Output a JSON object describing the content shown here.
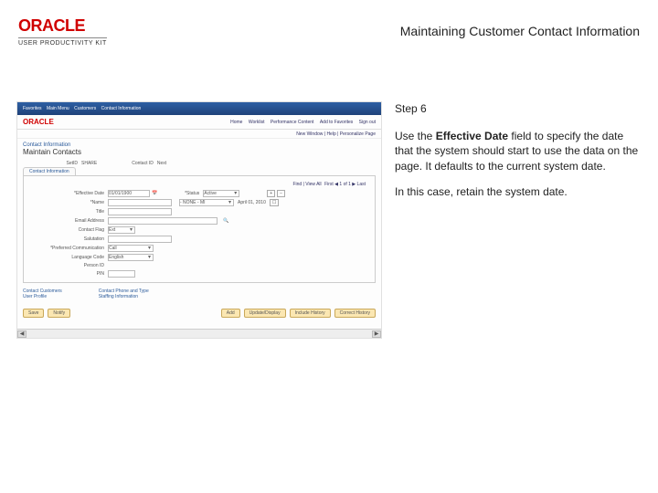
{
  "header": {
    "brand": "ORACLE",
    "brand_sub": "USER PRODUCTIVITY KIT",
    "title": "Maintaining Customer Contact Information"
  },
  "instructions": {
    "step": "Step 6",
    "p1_a": "Use the ",
    "p1_b": "Effective Date",
    "p1_c": " field to specify the date that the system should start to use the data on the page. It defaults to the current system date.",
    "p2": "In this case, retain the system date."
  },
  "app": {
    "crumbs": [
      "Favorites",
      "Main Menu",
      "Customers",
      "Contact Information"
    ],
    "topmenu": [
      "Home",
      "Worklist",
      "Performance Content",
      "Add to Favorites",
      "Sign out"
    ],
    "brand": "ORACLE",
    "subbar": "New Window | Help | Personalize Page",
    "section": "Contact Information",
    "page_title": "Maintain Contacts",
    "setid_row": {
      "lab1": "SetID",
      "val1": "SHARE",
      "lab2": "Contact ID",
      "val2": "Next"
    },
    "tab": "Contact Information",
    "find": {
      "label": "Find | View All",
      "nav": "First  ◀ 1 of 1 ▶  Last"
    },
    "fields": {
      "eff_date_label": "*Effective Date",
      "eff_date_val": "01/01/1900",
      "status_label": "*Status",
      "status_val": "Active",
      "name_label": "*Name",
      "name_val": "",
      "name_dd": "- NONE - MI",
      "name_date": "April 01, 2010",
      "title_label": "Title",
      "email_label": "Email Address",
      "contactflag_label": "Contact Flag",
      "contactflag_val": "Ext",
      "salutation_label": "Salutation",
      "prefcomm_label": "*Preferred Communication",
      "prefcomm_val": "Call",
      "langcode_label": "Language Code",
      "langcode_val": "English",
      "person_label": "Person ID",
      "pin_label": "PIN"
    },
    "bottom_links": {
      "a": "Contact Customers",
      "b": "Contact Phone and Type",
      "c": "User Profile",
      "d": "Staffing Information"
    },
    "footer_left": {
      "save": "Save",
      "notify": "Notify"
    },
    "footer_right": {
      "add": "Add",
      "update": "Update/Display",
      "history": "Include History",
      "correct": "Correct History"
    },
    "scroll_left": "◀",
    "scroll_right": "▶"
  }
}
